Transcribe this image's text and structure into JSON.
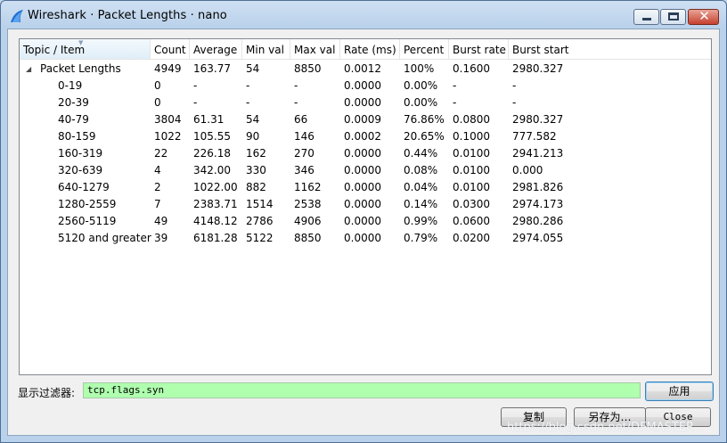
{
  "window": {
    "title": "Wireshark · Packet Lengths · nano",
    "app_icon": "wireshark-fin-icon",
    "controls": {
      "minimize": "minimize-icon",
      "maximize": "maximize-icon",
      "close": "close-icon",
      "close_glyph": "✕"
    }
  },
  "table": {
    "columns": [
      "Topic / Item",
      "Count",
      "Average",
      "Min val",
      "Max val",
      "Rate (ms)",
      "Percent",
      "Burst rate",
      "Burst start"
    ],
    "root": {
      "expander": "◢",
      "cells": [
        "Packet Lengths",
        "4949",
        "163.77",
        "54",
        "8850",
        "0.0012",
        "100%",
        "0.1600",
        "2980.327"
      ]
    },
    "rows": [
      [
        "0-19",
        "0",
        "-",
        "-",
        "-",
        "0.0000",
        "0.00%",
        "-",
        "-"
      ],
      [
        "20-39",
        "0",
        "-",
        "-",
        "-",
        "0.0000",
        "0.00%",
        "-",
        "-"
      ],
      [
        "40-79",
        "3804",
        "61.31",
        "54",
        "66",
        "0.0009",
        "76.86%",
        "0.0800",
        "2980.327"
      ],
      [
        "80-159",
        "1022",
        "105.55",
        "90",
        "146",
        "0.0002",
        "20.65%",
        "0.1000",
        "777.582"
      ],
      [
        "160-319",
        "22",
        "226.18",
        "162",
        "270",
        "0.0000",
        "0.44%",
        "0.0100",
        "2941.213"
      ],
      [
        "320-639",
        "4",
        "342.00",
        "330",
        "346",
        "0.0000",
        "0.08%",
        "0.0100",
        "0.000"
      ],
      [
        "640-1279",
        "2",
        "1022.00",
        "882",
        "1162",
        "0.0000",
        "0.04%",
        "0.0100",
        "2981.826"
      ],
      [
        "1280-2559",
        "7",
        "2383.71",
        "1514",
        "2538",
        "0.0000",
        "0.14%",
        "0.0300",
        "2974.173"
      ],
      [
        "2560-5119",
        "49",
        "4148.12",
        "2786",
        "4906",
        "0.0000",
        "0.99%",
        "0.0600",
        "2980.286"
      ],
      [
        "5120 and greater",
        "39",
        "6181.28",
        "5122",
        "8850",
        "0.0000",
        "0.79%",
        "0.0200",
        "2974.055"
      ]
    ]
  },
  "filter": {
    "label": "显示过滤器:",
    "value": "tcp.flags.syn"
  },
  "buttons": {
    "apply": "应用",
    "copy": "复制",
    "save_as": "另存为…",
    "close": "Close"
  },
  "watermark": "https://blog.csdn.net/DFMASTER",
  "colors": {
    "filter_bg": "#afffaf",
    "titlebar": "#c5d7ea"
  }
}
